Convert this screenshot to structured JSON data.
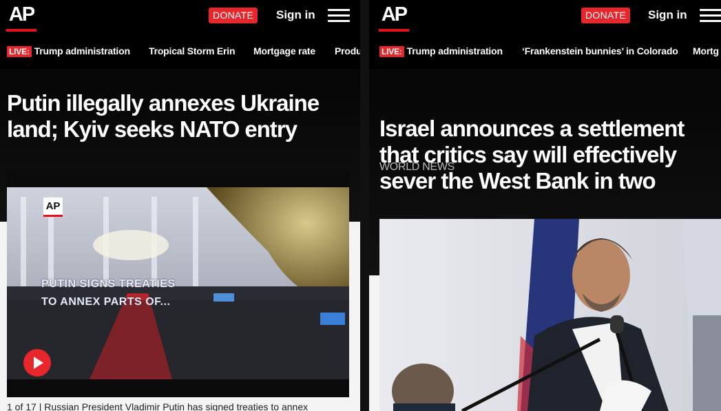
{
  "left": {
    "header": {
      "logo": "AP",
      "donate_label": "DONATE",
      "signin_label": "Sign in"
    },
    "trending": {
      "live_label": "LIVE:",
      "items": [
        "Trump administration",
        "Tropical Storm Erin",
        "Mortgage rate",
        "Produ"
      ]
    },
    "article": {
      "headline": "Putin illegally annexes Ukraine land; Kyiv seeks NATO entry",
      "video": {
        "logo": "AP",
        "overlay_text": [
          "PUTIN SIGNS TREATIES",
          "TO ANNEX PARTS OF..."
        ]
      },
      "caption": "1 of 17 |  Russian President Vladimir Putin has signed treaties to annex"
    }
  },
  "right": {
    "header": {
      "logo": "AP",
      "donate_label": "DONATE",
      "signin_label": "Sign in"
    },
    "trending": {
      "live_label": "LIVE:",
      "items": [
        "Trump administration",
        "‘Frankenstein bunnies’ in Colorado",
        "Mortg"
      ]
    },
    "article": {
      "category": "WORLD NEWS",
      "headline": "Israel announces a settlement that critics say will effectively sever the West Bank in two"
    }
  },
  "colors": {
    "accent": "#e8272c",
    "background": "#000000",
    "text": "#ffffff"
  }
}
